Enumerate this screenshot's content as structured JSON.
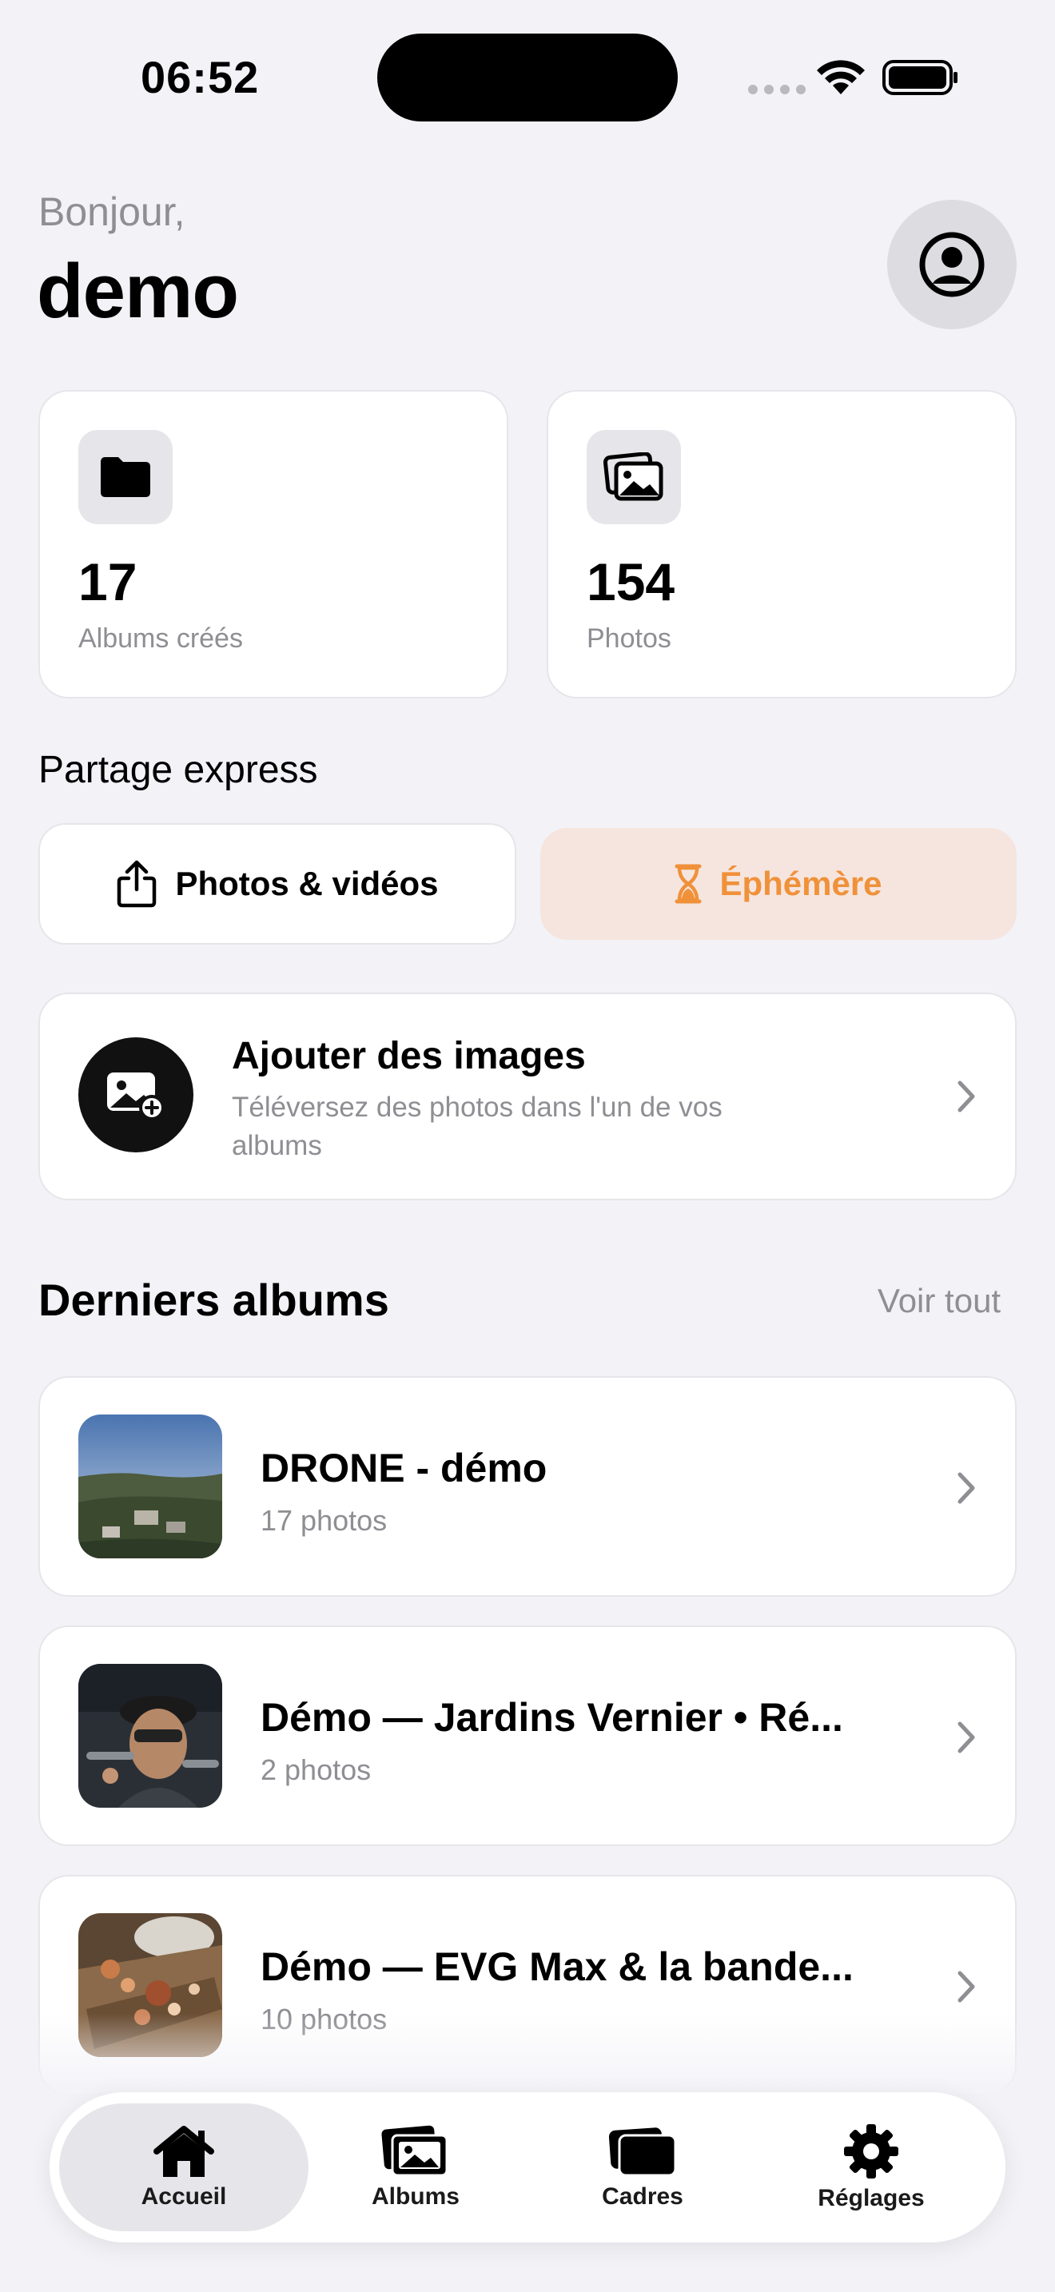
{
  "status": {
    "time": "06:52"
  },
  "header": {
    "greeting": "Bonjour,",
    "username": "demo"
  },
  "stats": [
    {
      "icon": "folder-icon",
      "value": "17",
      "label": "Albums créés"
    },
    {
      "icon": "photos-icon",
      "value": "154",
      "label": "Photos"
    }
  ],
  "share": {
    "title": "Partage express",
    "photos_label": "Photos & vidéos",
    "ephemeral_label": "Éphémère",
    "ephemeral_color": "#f0913a"
  },
  "add_images": {
    "title": "Ajouter des images",
    "subtitle": "Téléversez des photos dans l'un de vos albums"
  },
  "albums": {
    "title": "Derniers albums",
    "see_all": "Voir tout",
    "items": [
      {
        "name": "DRONE - démo",
        "count": "17 photos"
      },
      {
        "name": "Démo — Jardins Vernier • Ré...",
        "count": "2 photos"
      },
      {
        "name": "Démo — EVG Max & la bande...",
        "count": "10 photos"
      }
    ]
  },
  "tabs": [
    {
      "label": "Accueil",
      "icon": "home-icon",
      "active": true
    },
    {
      "label": "Albums",
      "icon": "albums-icon",
      "active": false
    },
    {
      "label": "Cadres",
      "icon": "frames-icon",
      "active": false
    },
    {
      "label": "Réglages",
      "icon": "gear-icon",
      "active": false
    }
  ]
}
